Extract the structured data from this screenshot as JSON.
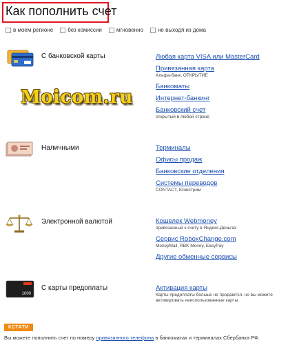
{
  "title": "Как пополнить счет",
  "filters": [
    {
      "label": "в моем регионе"
    },
    {
      "label": "без комиссии"
    },
    {
      "label": "мгновенно"
    },
    {
      "label": "не выходя из дома"
    }
  ],
  "watermark": "Moicom.ru",
  "sections": [
    {
      "label": "С банковской карты",
      "icon": "bank-cards-icon",
      "links": [
        {
          "text": "Любая карта VISA или MasterCard"
        },
        {
          "text": "Привязанная карта",
          "sub": "Альфа-банк, ОТКРЫТИЕ"
        },
        {
          "text": "Банкоматы"
        },
        {
          "text": "Интернет-банкинг"
        },
        {
          "text": "Банковский счет",
          "sub": "открытый в любой стране"
        }
      ]
    },
    {
      "label": "Наличными",
      "icon": "banknotes-icon",
      "links": [
        {
          "text": "Терминалы"
        },
        {
          "text": "Офисы продаж"
        },
        {
          "text": "Банковские отделения"
        },
        {
          "text": "Системы переводов",
          "sub": "CONTACT, Юнистрим"
        }
      ]
    },
    {
      "label": "Электронной валютой",
      "icon": "scales-icon",
      "links": [
        {
          "text": "Кошелек Webmoney",
          "sub": "привязанный к счету в Яндекс.Деньгах"
        },
        {
          "text": "Сервис RoboxChange.com",
          "sub": "MoneyMail, RBK Money, EasyPay"
        },
        {
          "text": "Другие обменные сервисы"
        }
      ]
    },
    {
      "label": "С карты предоплаты",
      "icon": "prepaid-card-icon",
      "card_text": "1000",
      "links": [
        {
          "text": "Активация карты",
          "sub": "Карты предоплаты больше не продаются, но вы можете активировать неиспользованные карты."
        }
      ]
    }
  ],
  "kstati": "КСТАТИ",
  "footer": {
    "before": "Вы можете пополнить счет по номеру ",
    "link": "привязанного телефона",
    "after": " в банкоматах и терминалах Сбербанка РФ."
  }
}
